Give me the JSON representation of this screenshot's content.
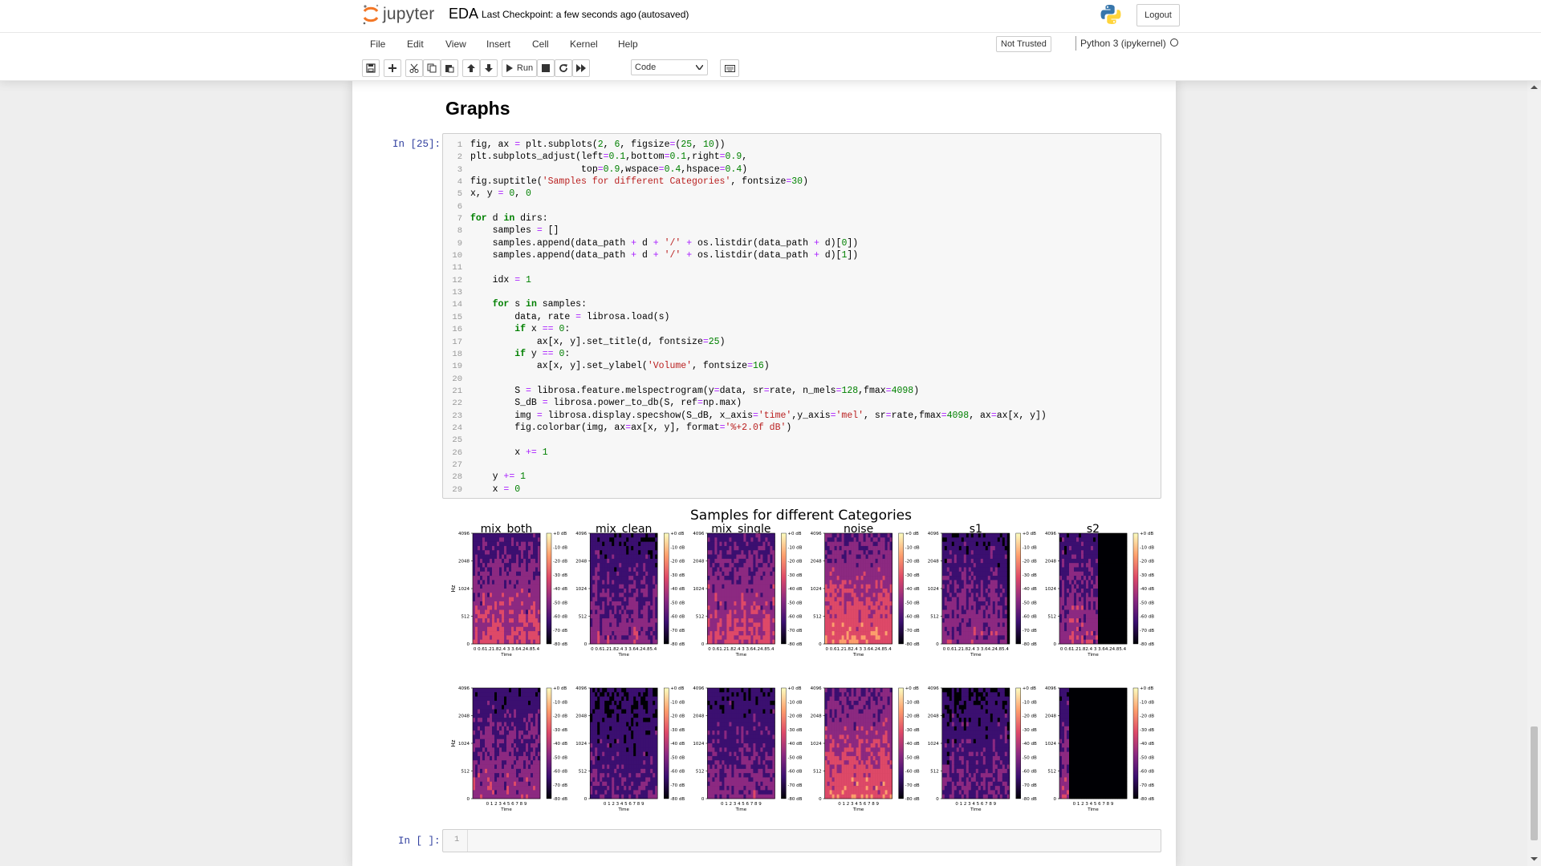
{
  "header": {
    "logo_text": "jupyter",
    "notebook_name": "EDA",
    "checkpoint": "Last Checkpoint: a few seconds ago",
    "autosave": "(autosaved)",
    "logout_label": "Logout"
  },
  "menu": {
    "items": [
      "File",
      "Edit",
      "View",
      "Insert",
      "Cell",
      "Kernel",
      "Help"
    ],
    "not_trusted": "Not Trusted",
    "kernel_name": "Python 3 (ipykernel)"
  },
  "toolbar": {
    "run_label": "Run",
    "cell_type": "Code",
    "icons": [
      "save-icon",
      "plus-icon",
      "cut-icon",
      "copy-icon",
      "paste-icon",
      "arrow-up-icon",
      "arrow-down-icon",
      "play-icon",
      "stop-icon",
      "restart-icon",
      "fast-forward-icon",
      "keyboard-icon"
    ]
  },
  "notebook": {
    "heading": "Graphs",
    "cell1_prompt": "In [25]:",
    "cell2_prompt": "In [ ]:",
    "cell2_line_number": "1",
    "code_lines": [
      "fig, ax = plt.subplots(2, 6, figsize=(25, 10))",
      "plt.subplots_adjust(left=0.1,bottom=0.1,right=0.9,",
      "                    top=0.9,wspace=0.4,hspace=0.4)",
      "fig.suptitle('Samples for different Categories', fontsize=30)",
      "x, y = 0, 0",
      "",
      "for d in dirs:",
      "    samples = []",
      "    samples.append(data_path + d + '/' + os.listdir(data_path + d)[0])",
      "    samples.append(data_path + d + '/' + os.listdir(data_path + d)[1])",
      "",
      "    idx = 1",
      "",
      "    for s in samples:",
      "        data, rate = librosa.load(s)",
      "        if x == 0:",
      "            ax[x, y].set_title(d, fontsize=25)",
      "        if y == 0:",
      "            ax[x, y].set_ylabel('Volume', fontsize=16)",
      "",
      "        S = librosa.feature.melspectrogram(y=data, sr=rate, n_mels=128,fmax=4098)",
      "        S_dB = librosa.power_to_db(S, ref=np.max)",
      "        img = librosa.display.specshow(S_dB, x_axis='time',y_axis='mel', sr=rate,fmax=4098, ax=ax[x, y])",
      "        fig.colorbar(img, ax=ax[x, y], format='%+2.0f dB')",
      "",
      "        x += 1",
      "",
      "    y += 1",
      "    x = 0"
    ]
  },
  "figure": {
    "suptitle": "Samples for different Categories",
    "column_titles": [
      "mix_both",
      "mix_clean",
      "mix_single",
      "noise",
      "s1",
      "s2"
    ],
    "ylabel": "Hz",
    "xlabel": "Time",
    "y_ticks": [
      "4096",
      "2048",
      "1024",
      "512",
      "0"
    ],
    "colorbar_ticks": [
      "+0 dB",
      "-10 dB",
      "-20 dB",
      "-30 dB",
      "-40 dB",
      "-50 dB",
      "-60 dB",
      "-70 dB",
      "-80 dB"
    ],
    "row1_x_ticks": "0 0.61.21.82.4 3 3.64.24.85.4",
    "row2_x_ticks": "0 1 2 3 4 5 6 7 8 9",
    "colormap": [
      "#000004",
      "#3b0f70",
      "#8c2981",
      "#de4968",
      "#fe9f6d",
      "#fcfdbf"
    ]
  }
}
